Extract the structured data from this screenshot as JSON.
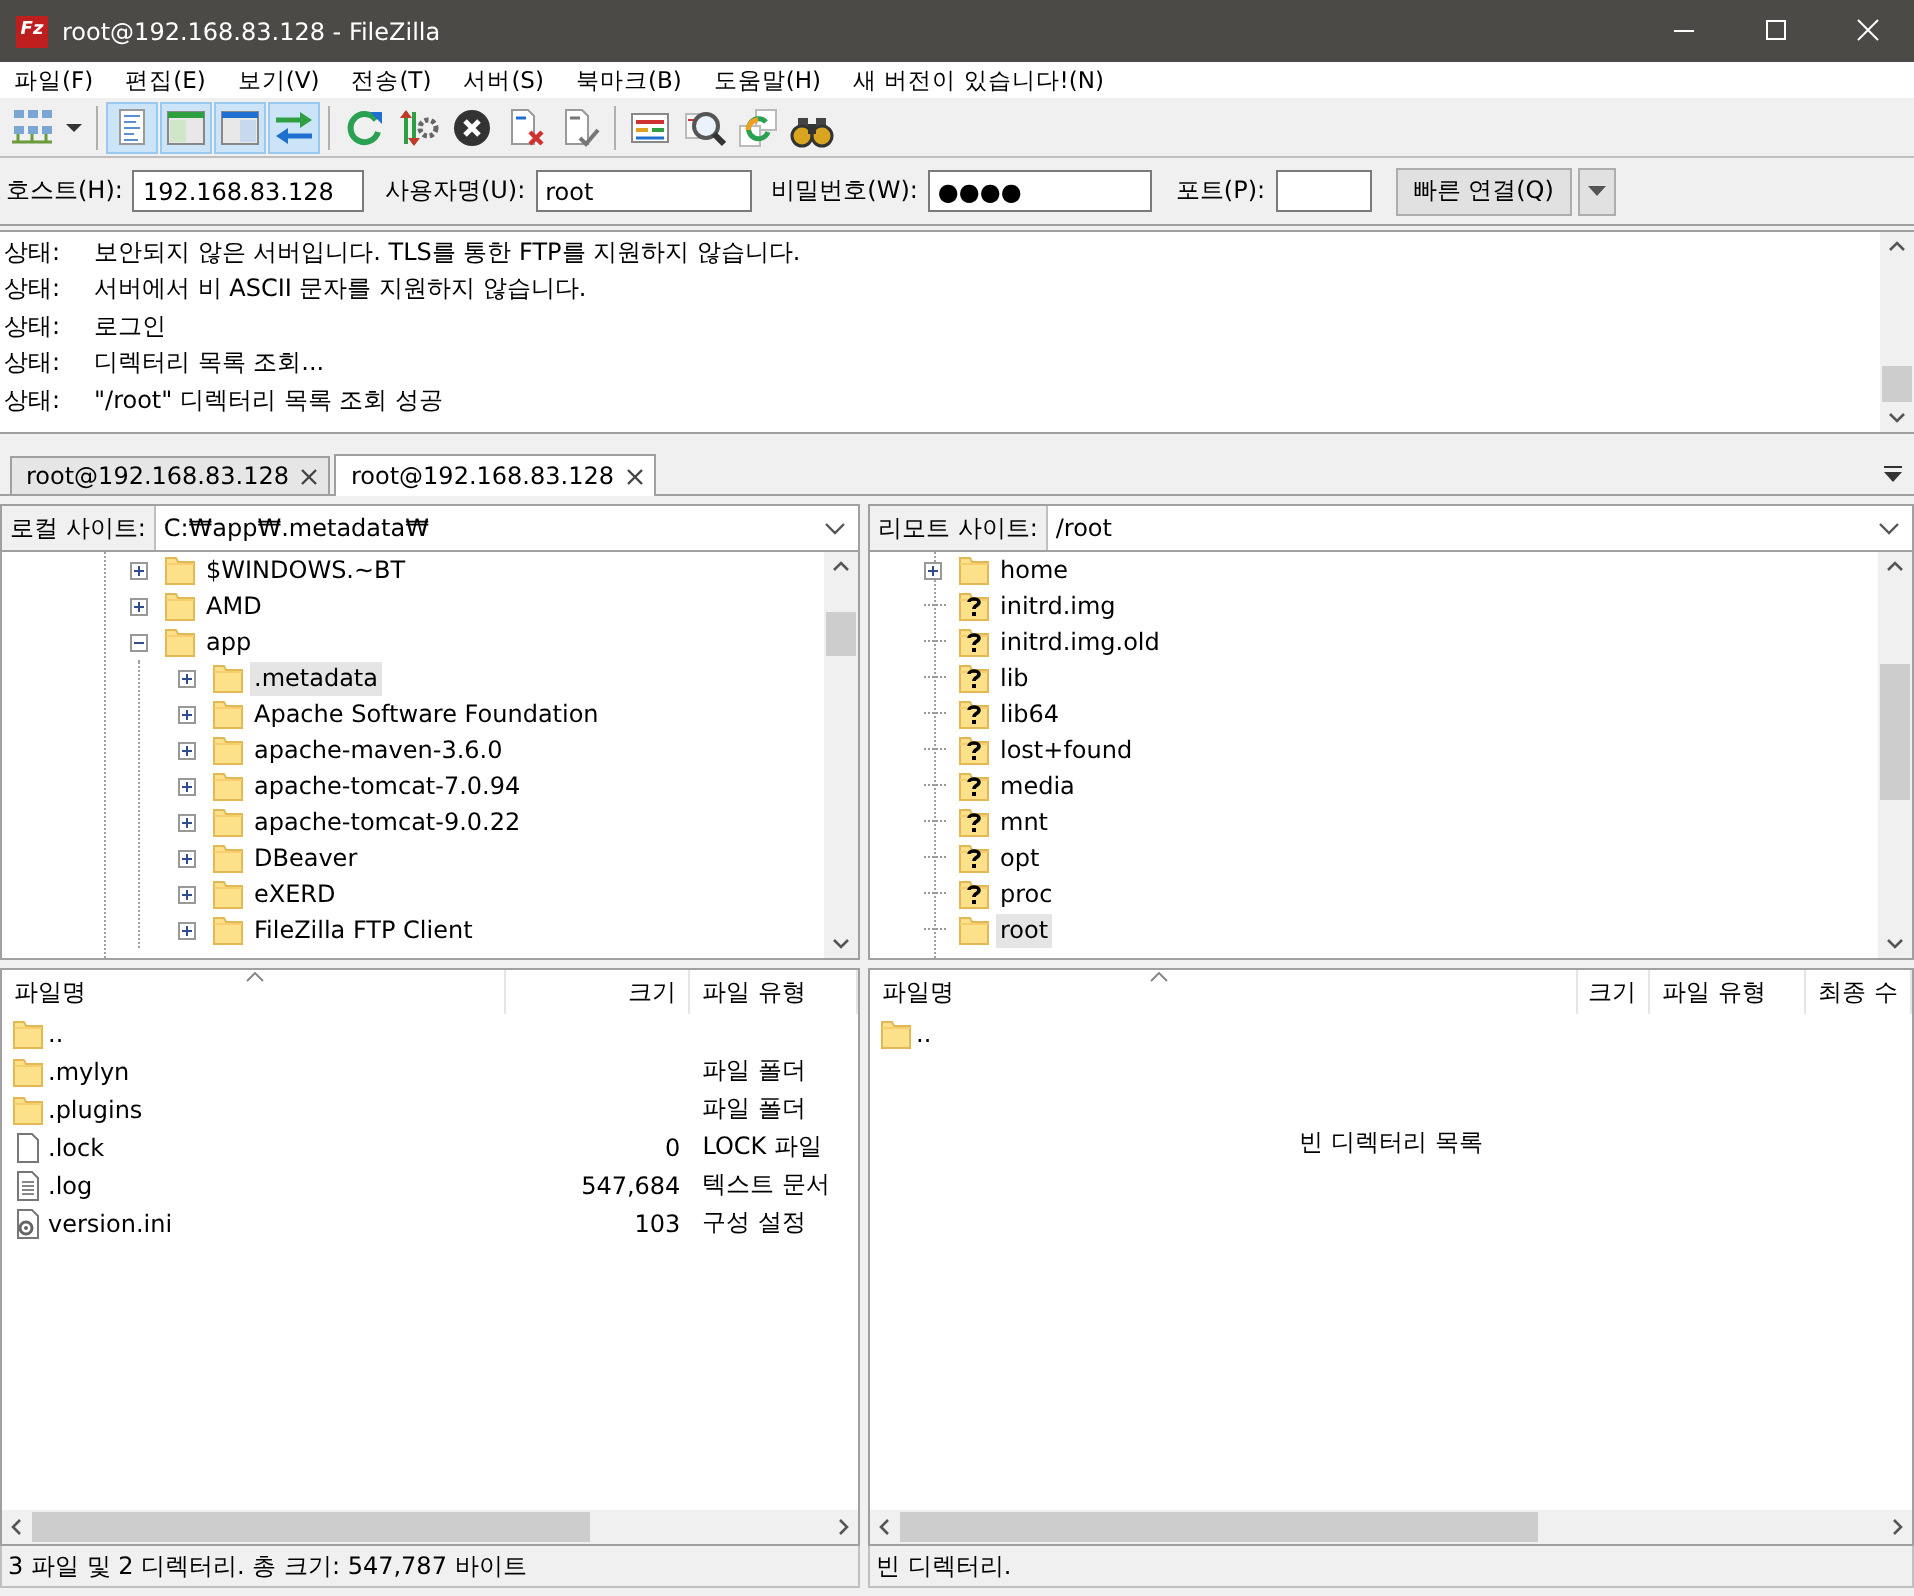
{
  "window": {
    "icon_text": "Fz",
    "title": "root@192.168.83.128 - FileZilla"
  },
  "menu": [
    {
      "label": "파일(F)"
    },
    {
      "label": "편집(E)"
    },
    {
      "label": "보기(V)"
    },
    {
      "label": "전송(T)"
    },
    {
      "label": "서버(S)"
    },
    {
      "label": "북마크(B)"
    },
    {
      "label": "도움말(H)"
    },
    {
      "label": "새 버전이 있습니다!(N)"
    }
  ],
  "toolbar": [
    [
      {
        "kind": "site-manager",
        "pressed": false
      },
      {
        "kind": "menu-caret",
        "pressed": false
      }
    ],
    [
      {
        "kind": "log",
        "pressed": true
      },
      {
        "kind": "local-tree",
        "pressed": true
      },
      {
        "kind": "remote-tree",
        "pressed": true
      },
      {
        "kind": "queue",
        "pressed": true
      }
    ],
    [
      {
        "kind": "refresh",
        "pressed": false
      },
      {
        "kind": "process",
        "pressed": false
      },
      {
        "kind": "cancel",
        "pressed": false
      },
      {
        "kind": "disconnect",
        "pressed": false
      },
      {
        "kind": "reconnect",
        "pressed": false
      }
    ],
    [
      {
        "kind": "compare",
        "pressed": false
      },
      {
        "kind": "filter",
        "pressed": false
      },
      {
        "kind": "sync",
        "pressed": false
      },
      {
        "kind": "find",
        "pressed": false
      }
    ]
  ],
  "quickconnect": {
    "fields": [
      {
        "label": "호스트(H):",
        "value": "192.168.83.128",
        "kind": "host"
      },
      {
        "label": "사용자명(U):",
        "value": "root",
        "kind": "user"
      },
      {
        "label": "비밀번호(W):",
        "value": "●●●●",
        "kind": "password"
      },
      {
        "label": "포트(P):",
        "kind": "port"
      }
    ],
    "button": "빠른 연결(Q)"
  },
  "log": [
    {
      "label": "상태:",
      "text": "보안되지 않은 서버입니다. TLS를 통한 FTP를 지원하지 않습니다."
    },
    {
      "label": "상태:",
      "text": "서버에서 비 ASCII 문자를 지원하지 않습니다."
    },
    {
      "label": "상태:",
      "text": "로그인"
    },
    {
      "label": "상태:",
      "text": "디렉터리 목록 조회..."
    },
    {
      "label": "상태:",
      "text": "\"/root\" 디렉터리 목록 조회 성공"
    }
  ],
  "tabs": [
    {
      "label": "root@192.168.83.128",
      "selected": false
    },
    {
      "label": "root@192.168.83.128",
      "selected": true
    }
  ],
  "local": {
    "site_label": "로컬 사이트:",
    "path": "C:₩app₩.metadata₩",
    "tree": [
      {
        "name": "$WINDOWS.~BT",
        "kind": "folder",
        "expanded": false,
        "selected": false
      },
      {
        "name": "AMD",
        "kind": "folder",
        "expanded": false,
        "selected": false
      },
      {
        "name": "app",
        "kind": "folder",
        "expanded": true,
        "selected": false,
        "children": [
          {
            "name": ".metadata",
            "kind": "folder",
            "expanded": false,
            "selected": true
          },
          {
            "name": "Apache Software Foundation",
            "kind": "folder",
            "expanded": false,
            "selected": false
          },
          {
            "name": "apache-maven-3.6.0",
            "kind": "folder",
            "expanded": false,
            "selected": false
          },
          {
            "name": "apache-tomcat-7.0.94",
            "kind": "folder",
            "expanded": false,
            "selected": false
          },
          {
            "name": "apache-tomcat-9.0.22",
            "kind": "folder",
            "expanded": false,
            "selected": false
          },
          {
            "name": "DBeaver",
            "kind": "folder",
            "expanded": false,
            "selected": false
          },
          {
            "name": "eXERD",
            "kind": "folder",
            "expanded": false,
            "selected": false
          },
          {
            "name": "FileZilla FTP Client",
            "kind": "folder",
            "expanded": false,
            "selected": false
          }
        ]
      }
    ],
    "columns": [
      {
        "label": "파일명",
        "kind": "name"
      },
      {
        "label": "크기",
        "kind": "size"
      },
      {
        "label": "파일 유형",
        "kind": "type"
      }
    ],
    "files": [
      {
        "name": "..",
        "kind": "folder"
      },
      {
        "name": ".mylyn",
        "kind": "folder",
        "type": "파일 폴더"
      },
      {
        "name": ".plugins",
        "kind": "folder",
        "type": "파일 폴더"
      },
      {
        "name": ".lock",
        "kind": "file",
        "size": "0",
        "type": "LOCK 파일"
      },
      {
        "name": ".log",
        "kind": "text",
        "size": "547,684",
        "type": "텍스트 문서"
      },
      {
        "name": "version.ini",
        "kind": "config",
        "size": "103",
        "type": "구성 설정"
      }
    ],
    "status": "3 파일 및 2 디렉터리. 총 크기: 547,787 바이트"
  },
  "remote": {
    "site_label": "리모트 사이트:",
    "path": "/root",
    "tree": [
      {
        "name": "home",
        "kind": "folder",
        "expanded": false,
        "selected": false
      },
      {
        "name": "initrd.img",
        "kind": "unknown",
        "selected": false
      },
      {
        "name": "initrd.img.old",
        "kind": "unknown",
        "selected": false
      },
      {
        "name": "lib",
        "kind": "unknown",
        "selected": false
      },
      {
        "name": "lib64",
        "kind": "unknown",
        "selected": false
      },
      {
        "name": "lost+found",
        "kind": "unknown",
        "selected": false
      },
      {
        "name": "media",
        "kind": "unknown",
        "selected": false
      },
      {
        "name": "mnt",
        "kind": "unknown",
        "selected": false
      },
      {
        "name": "opt",
        "kind": "unknown",
        "selected": false
      },
      {
        "name": "proc",
        "kind": "unknown",
        "selected": false
      },
      {
        "name": "root",
        "kind": "folder",
        "selected": true
      }
    ],
    "columns": [
      {
        "label": "파일명",
        "kind": "name"
      },
      {
        "label": "크기",
        "kind": "size"
      },
      {
        "label": "파일 유형",
        "kind": "type"
      },
      {
        "label": "최종 수",
        "kind": "date"
      }
    ],
    "files": [
      {
        "name": "..",
        "kind": "folder"
      }
    ],
    "empty_message": "빈 디렉터리 목록",
    "status": "빈 디렉터리."
  }
}
